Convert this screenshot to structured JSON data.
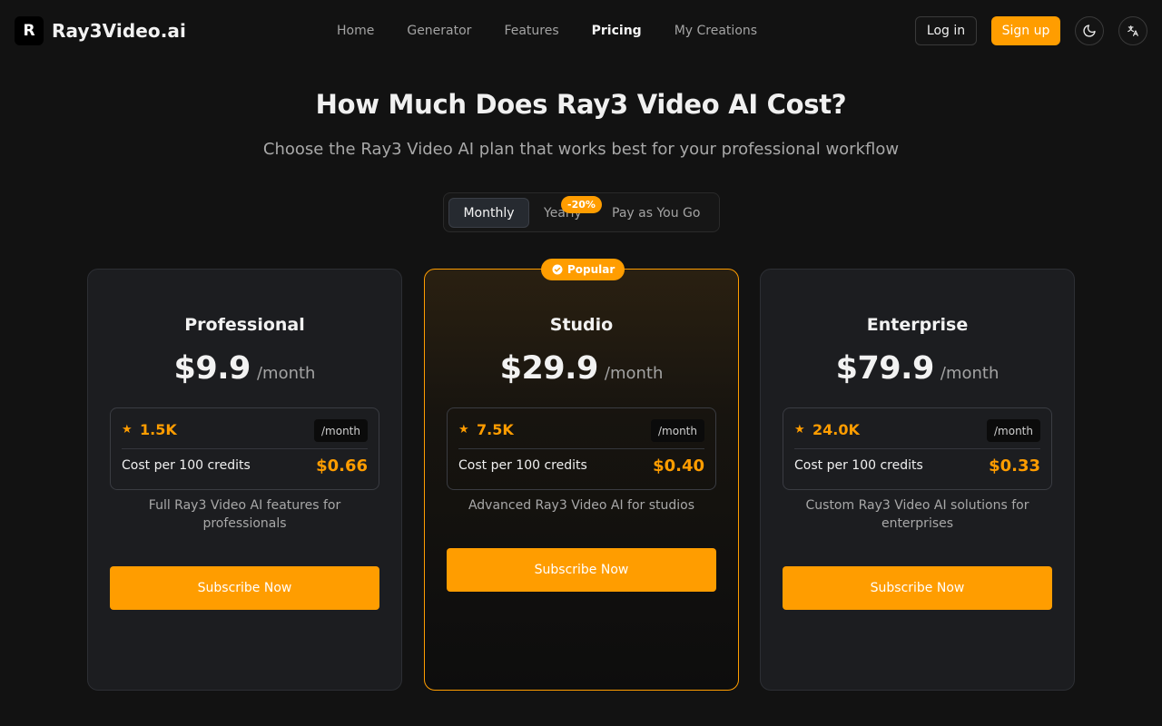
{
  "brand": {
    "logo_letter": "R",
    "name": "Ray3Video.ai"
  },
  "nav": {
    "items": [
      {
        "label": "Home",
        "active": false
      },
      {
        "label": "Generator",
        "active": false
      },
      {
        "label": "Features",
        "active": false
      },
      {
        "label": "Pricing",
        "active": true
      },
      {
        "label": "My Creations",
        "active": false
      }
    ]
  },
  "header": {
    "login_label": "Log in",
    "signup_label": "Sign up",
    "theme_icon": "moon-icon",
    "language_icon": "translate-icon"
  },
  "hero": {
    "title": "How Much Does Ray3 Video AI Cost?",
    "subtitle": "Choose the Ray3 Video AI plan that works best for your professional workflow"
  },
  "billing": {
    "options": [
      "Monthly",
      "Yearly",
      "Pay as You Go"
    ],
    "selected": "Monthly",
    "yearly_badge": "-20%"
  },
  "plans": [
    {
      "name": "Professional",
      "price": "$9.9",
      "period": "/month",
      "credits": "1.5K",
      "credits_unit": "/month",
      "cost_label": "Cost per 100 credits",
      "cost_value": "$0.66",
      "description": "Full Ray3 Video AI features for professionals",
      "cta": "Subscribe Now",
      "featured": false
    },
    {
      "name": "Studio",
      "price": "$29.9",
      "period": "/month",
      "credits": "7.5K",
      "credits_unit": "/month",
      "cost_label": "Cost per 100 credits",
      "cost_value": "$0.40",
      "description": "Advanced Ray3 Video AI for studios",
      "cta": "Subscribe Now",
      "featured": true,
      "badge": "Popular"
    },
    {
      "name": "Enterprise",
      "price": "$79.9",
      "period": "/month",
      "credits": "24.0K",
      "credits_unit": "/month",
      "cost_label": "Cost per 100 credits",
      "cost_value": "$0.33",
      "description": "Custom Ray3 Video AI solutions for enterprises",
      "cta": "Subscribe Now",
      "featured": false
    }
  ],
  "colors": {
    "accent": "#ff9d00",
    "background": "#121212",
    "card": "#1c1d20",
    "muted_text": "#a3a3a3"
  }
}
